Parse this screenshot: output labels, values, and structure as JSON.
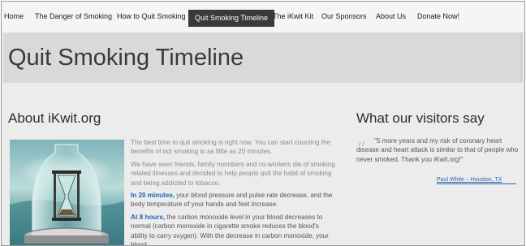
{
  "nav": {
    "items": [
      {
        "label": "Home"
      },
      {
        "label": "The Danger of Smoking"
      },
      {
        "label": "How to Quit Smoking"
      },
      {
        "label": "Quit Smoking Timeline",
        "active": true
      },
      {
        "label": "The iKwit Kit"
      },
      {
        "label": "Our Sponsors"
      },
      {
        "label": "About Us"
      },
      {
        "label": "Donate Now!"
      }
    ]
  },
  "header": {
    "title": "Quit Smoking Timeline"
  },
  "about": {
    "title": "About iKwit.org",
    "image_alt": "hourglass in glass bell jar",
    "paragraphs": {
      "p1": "The best time to quit smoking is right now. You can start counting the benefits of not smoking in as little as 20 minutes.",
      "p2": "We have seen friends, family members and co-workers die of smoking related illnesses and decided to help people quit the habit of smoking and being addicted to tobacco.",
      "p3_highlight": "In 20 minutes,",
      "p3_rest": " your blood pressure and pulse rate decrease, and the body temperature of your hands and feet increase.",
      "p4_highlight": "At 8 hours,",
      "p4_rest": " the carbon monoxide level in your blood decreases to normal (carbon monoxide in cigarette smoke reduces the blood's ability to carry oxygen). With the decrease in carbon monoxide, your blood"
    }
  },
  "visitors": {
    "title": "What our visitors say",
    "quote_mark": "“",
    "quote": "\"5 more years and my risk of coronary heart disease and heart attack is similar to that of people who never smoked. Thank you iKwit.org!\"",
    "author": "Paul White – Houston, TX"
  },
  "colors": {
    "accent": "#1f63b0",
    "nav_active_bg": "#3a3a3a",
    "header_bg": "#d9d9d9"
  }
}
